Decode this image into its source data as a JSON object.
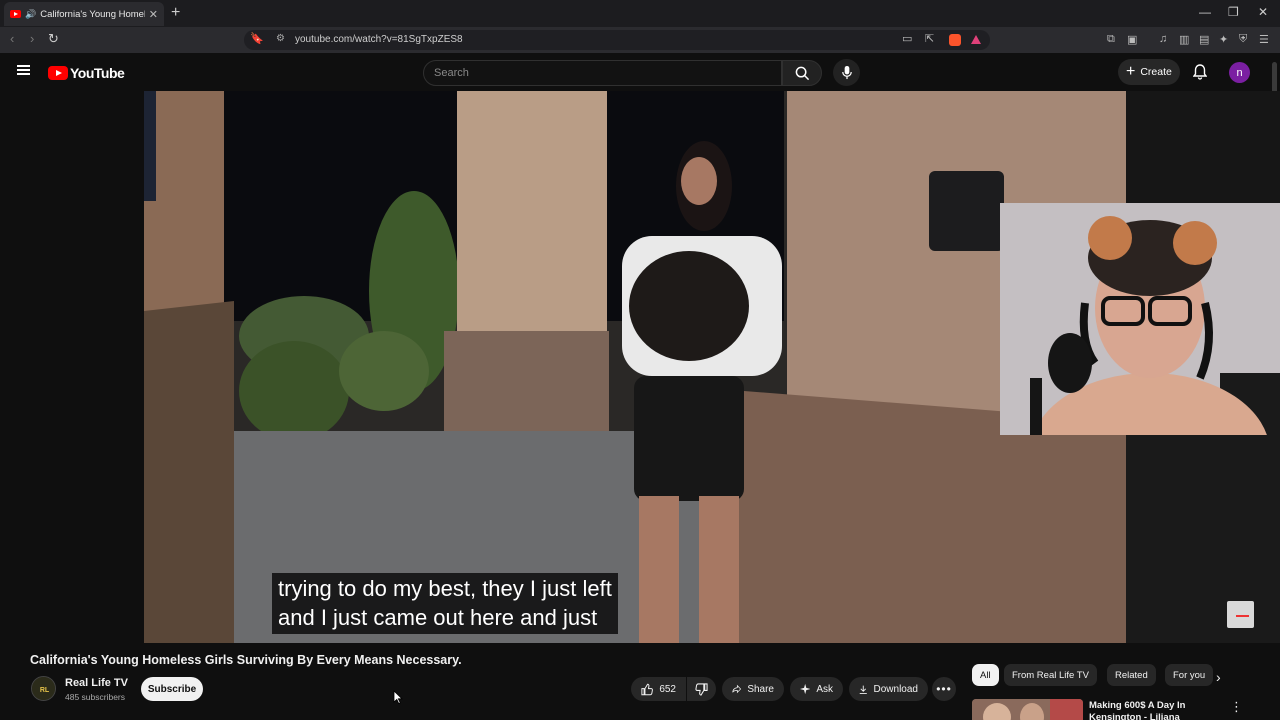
{
  "browser": {
    "tab_title": "California's Young Homeless G",
    "url": "youtube.com/watch?v=81SgTxpZES8"
  },
  "masthead": {
    "logo_text": "YouTube",
    "search_placeholder": "Search",
    "create_label": "Create",
    "avatar_initial": "n"
  },
  "video": {
    "caption_line1": "trying to do my best, they I just left",
    "caption_line2": "and I just came out here and just"
  },
  "details": {
    "title": "California's Young Homeless Girls Surviving By Every Means Necessary.",
    "channel_name": "Real Life TV",
    "subscribers": "485 subscribers",
    "subscribe_label": "Subscribe",
    "like_count": "652",
    "share_label": "Share",
    "ask_label": "Ask",
    "download_label": "Download"
  },
  "sidebar": {
    "chips": [
      "All",
      "From Real Life TV",
      "Related",
      "For you"
    ],
    "rec_title": "Making 600$ A Day In Kensington - Liliana"
  },
  "colors": {
    "background": "#0f0f0f",
    "brand_red": "#ff0000",
    "avatar_purple": "#7b1fa2"
  }
}
